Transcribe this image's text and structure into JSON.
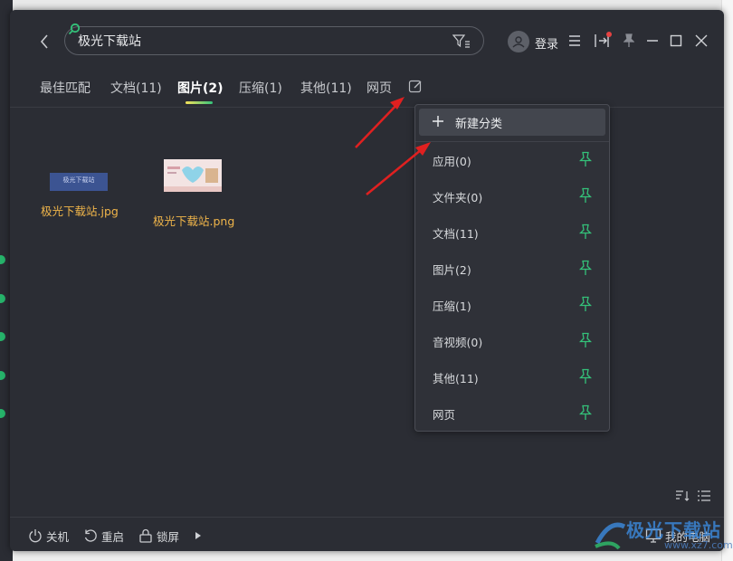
{
  "window": {
    "title": "极光下载站"
  },
  "search": {
    "value": "极光下载站"
  },
  "header": {
    "login_label": "登录"
  },
  "tabs": [
    {
      "label": "最佳匹配",
      "active": false
    },
    {
      "label": "文档(11)",
      "active": false
    },
    {
      "label": "图片(2)",
      "active": true
    },
    {
      "label": "压缩(1)",
      "active": false
    },
    {
      "label": "其他(11)",
      "active": false
    },
    {
      "label": "网页",
      "active": false
    }
  ],
  "files": [
    {
      "name": "极光下载站.jpg",
      "thumb_text": "极光下载站"
    },
    {
      "name": "极光下载站.png"
    }
  ],
  "menu": {
    "new_label": "新建分类",
    "items": [
      {
        "label": "应用(0)"
      },
      {
        "label": "文件夹(0)"
      },
      {
        "label": "文档(11)"
      },
      {
        "label": "图片(2)"
      },
      {
        "label": "压缩(1)"
      },
      {
        "label": "音视频(0)"
      },
      {
        "label": "其他(11)"
      },
      {
        "label": "网页"
      }
    ]
  },
  "footer": {
    "shutdown": "关机",
    "restart": "重启",
    "lock": "锁屏",
    "computer": "我的电脑"
  },
  "watermark": {
    "title": "极光下载站",
    "url": "www.xz7.com"
  },
  "colors": {
    "window_bg": "#2b2d34",
    "accent_green": "#34c27a",
    "file_name": "#f0b54a",
    "arrow_red": "#e02020"
  }
}
